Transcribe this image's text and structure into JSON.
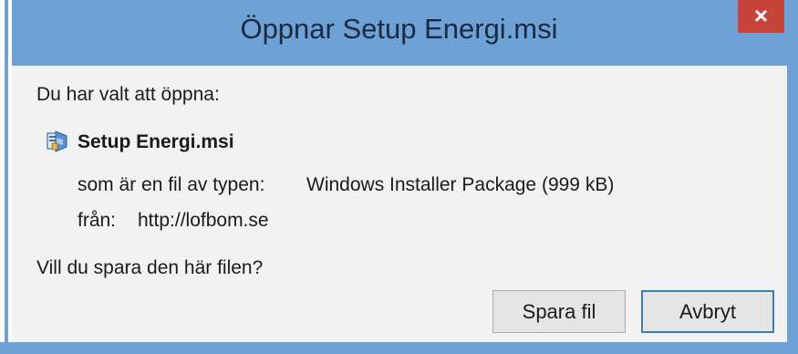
{
  "window": {
    "title": "Öppnar Setup Energi.msi",
    "close_label": "×"
  },
  "content": {
    "intro": "Du har valt att öppna:",
    "file_name": "Setup Energi.msi",
    "type_label": "som är en fil av typen:",
    "type_value": "Windows Installer Package (999 kB)",
    "source_label": "från:",
    "source_value": "http://lofbom.se",
    "question": "Vill du spara den här filen?"
  },
  "buttons": {
    "save": "Spara fil",
    "cancel": "Avbryt"
  },
  "icons": {
    "file": "installer-package-icon",
    "close": "close-icon"
  },
  "colors": {
    "title_bar": "#6ea1d6",
    "close_button": "#c7443a",
    "body": "#f2f2f2",
    "default_button_border": "#3c7fb1"
  }
}
